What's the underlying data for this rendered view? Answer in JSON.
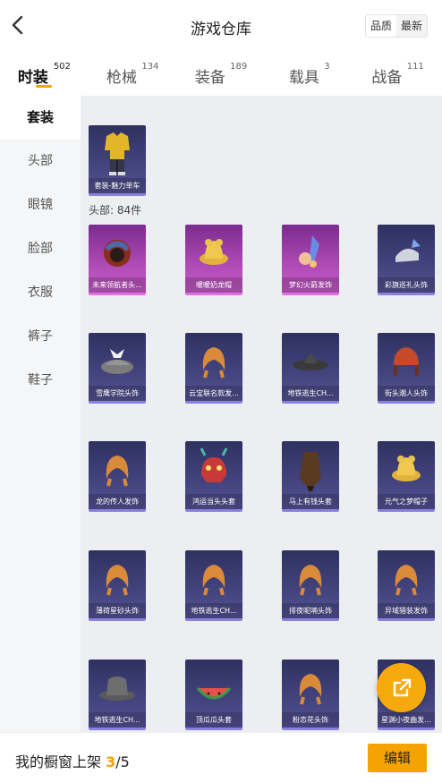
{
  "header": {
    "title": "游戏仓库",
    "sort_options": [
      "品质",
      "最新"
    ]
  },
  "tabs": [
    {
      "label": "时装",
      "count": "502"
    },
    {
      "label": "枪械",
      "count": "134"
    },
    {
      "label": "装备",
      "count": "189"
    },
    {
      "label": "载具",
      "count": "3"
    },
    {
      "label": "战备",
      "count": "111"
    }
  ],
  "sidebar": {
    "items": [
      "套装",
      "头部",
      "眼镜",
      "脸部",
      "衣服",
      "裤子",
      "鞋子"
    ]
  },
  "outfit_section": {
    "items": [
      {
        "label": "套装-魅力单车",
        "icon": "outfit-icon"
      }
    ]
  },
  "head_section": {
    "title": "头部: 84件",
    "items": [
      {
        "label": "未来领航者头...",
        "icon": "helmet-icon",
        "rarity": "epic"
      },
      {
        "label": "暖暖奶龙帽",
        "icon": "hat-icon",
        "rarity": "epic"
      },
      {
        "label": "梦幻火箭发饰",
        "icon": "rocket-hairpin-icon",
        "rarity": "epic"
      },
      {
        "label": "彩旗巡礼头饰",
        "icon": "headwear-icon",
        "rarity": "rare"
      },
      {
        "label": "雪鹰学院头饰",
        "icon": "beret-icon",
        "rarity": "rare"
      },
      {
        "label": "云宝联名款发...",
        "icon": "hair-icon",
        "rarity": "rare"
      },
      {
        "label": "地铁逃生CH...",
        "icon": "straw-hat-icon",
        "rarity": "rare"
      },
      {
        "label": "街头潮人头饰",
        "icon": "cap-icon",
        "rarity": "rare"
      },
      {
        "label": "龙的传人发饰",
        "icon": "hair-icon",
        "rarity": "rare"
      },
      {
        "label": "鸿运当头头套",
        "icon": "dragon-mask-icon",
        "rarity": "rare"
      },
      {
        "label": "马上有钱头套",
        "icon": "horse-mask-icon",
        "rarity": "rare"
      },
      {
        "label": "元气之梦帽子",
        "icon": "hat-icon",
        "rarity": "rare"
      },
      {
        "label": "薄荷星砂头饰",
        "icon": "hair-icon",
        "rarity": "rare"
      },
      {
        "label": "地铁逃生CH...",
        "icon": "hair-icon",
        "rarity": "rare"
      },
      {
        "label": "排夜呢喃头饰",
        "icon": "hair-icon",
        "rarity": "rare"
      },
      {
        "label": "异域猎装发饰",
        "icon": "hair-icon",
        "rarity": "rare"
      },
      {
        "label": "地铁逃生CH...",
        "icon": "bucket-hat-icon",
        "rarity": "rare"
      },
      {
        "label": "顶瓜瓜头套",
        "icon": "watermelon-hat-icon",
        "rarity": "rare"
      },
      {
        "label": "粉恋花头饰",
        "icon": "hair-icon",
        "rarity": "rare"
      },
      {
        "label": "星渊小夜曲发...",
        "icon": "hair-icon",
        "rarity": "rare"
      }
    ]
  },
  "showcase": {
    "prefix": "我的橱窗上架 ",
    "current": "3",
    "total": "/5",
    "edit_label": "编辑"
  },
  "colors": {
    "accent": "#f5a300",
    "epic_card": "#b04bb5",
    "rare_card": "#43447e"
  },
  "fab_icon": "share-icon"
}
